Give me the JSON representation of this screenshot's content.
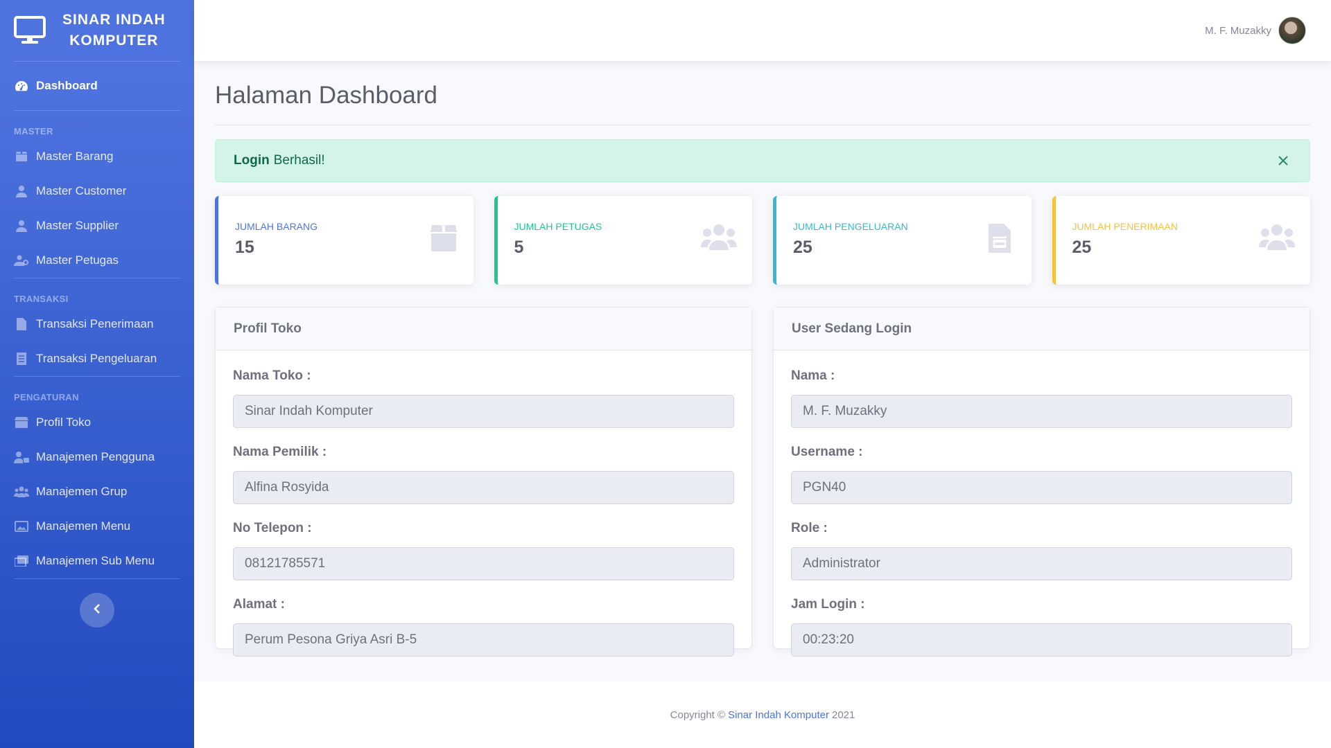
{
  "brand": {
    "line1": "SINAR INDAH",
    "line2": "KOMPUTER",
    "icon": "desktop-icon"
  },
  "sidebar": {
    "dashboard": "Dashboard",
    "heading_master": "MASTER",
    "master_items": [
      "Master Barang",
      "Master Customer",
      "Master Supplier",
      "Master Petugas"
    ],
    "heading_transaksi": "TRANSAKSI",
    "transaksi_items": [
      "Transaksi Penerimaan",
      "Transaksi Pengeluaran"
    ],
    "heading_pengaturan": "PENGATURAN",
    "pengaturan_items": [
      "Profil Toko",
      "Manajemen Pengguna",
      "Manajemen Grup",
      "Manajemen Menu",
      "Manajemen Sub Menu"
    ]
  },
  "topbar": {
    "user_name": "M. F. Muzakky"
  },
  "page": {
    "title": "Halaman Dashboard"
  },
  "alert": {
    "bold": "Login",
    "text": "Berhasil!"
  },
  "cards": [
    {
      "label": "JUMLAH BARANG",
      "value": "15",
      "icon": "box-icon",
      "color": "#4e73df"
    },
    {
      "label": "JUMLAH PETUGAS",
      "value": "5",
      "icon": "users-icon",
      "color": "#1cc88a"
    },
    {
      "label": "JUMLAH PENGELUARAN",
      "value": "25",
      "icon": "document-icon",
      "color": "#36b9cc"
    },
    {
      "label": "JUMLAH PENERIMAAN",
      "value": "25",
      "icon": "users-icon",
      "color": "#f6c23e"
    }
  ],
  "profil": {
    "title": "Profil Toko",
    "fields": [
      {
        "label": "Nama Toko :",
        "value": "Sinar Indah Komputer"
      },
      {
        "label": "Nama Pemilik :",
        "value": "Alfina Rosyida"
      },
      {
        "label": "No Telepon :",
        "value": "08121785571"
      },
      {
        "label": "Alamat :",
        "value": "Perum Pesona Griya Asri B-5"
      }
    ]
  },
  "user": {
    "title": "User Sedang Login",
    "fields": [
      {
        "label": "Nama :",
        "value": "M. F. Muzakky"
      },
      {
        "label": "Username :",
        "value": "PGN40"
      },
      {
        "label": "Role :",
        "value": "Administrator"
      },
      {
        "label": "Jam Login :",
        "value": "00:23:20"
      }
    ]
  },
  "footer": {
    "prefix": "Copyright ©",
    "link": "Sinar Indah Komputer",
    "year": "2021"
  }
}
